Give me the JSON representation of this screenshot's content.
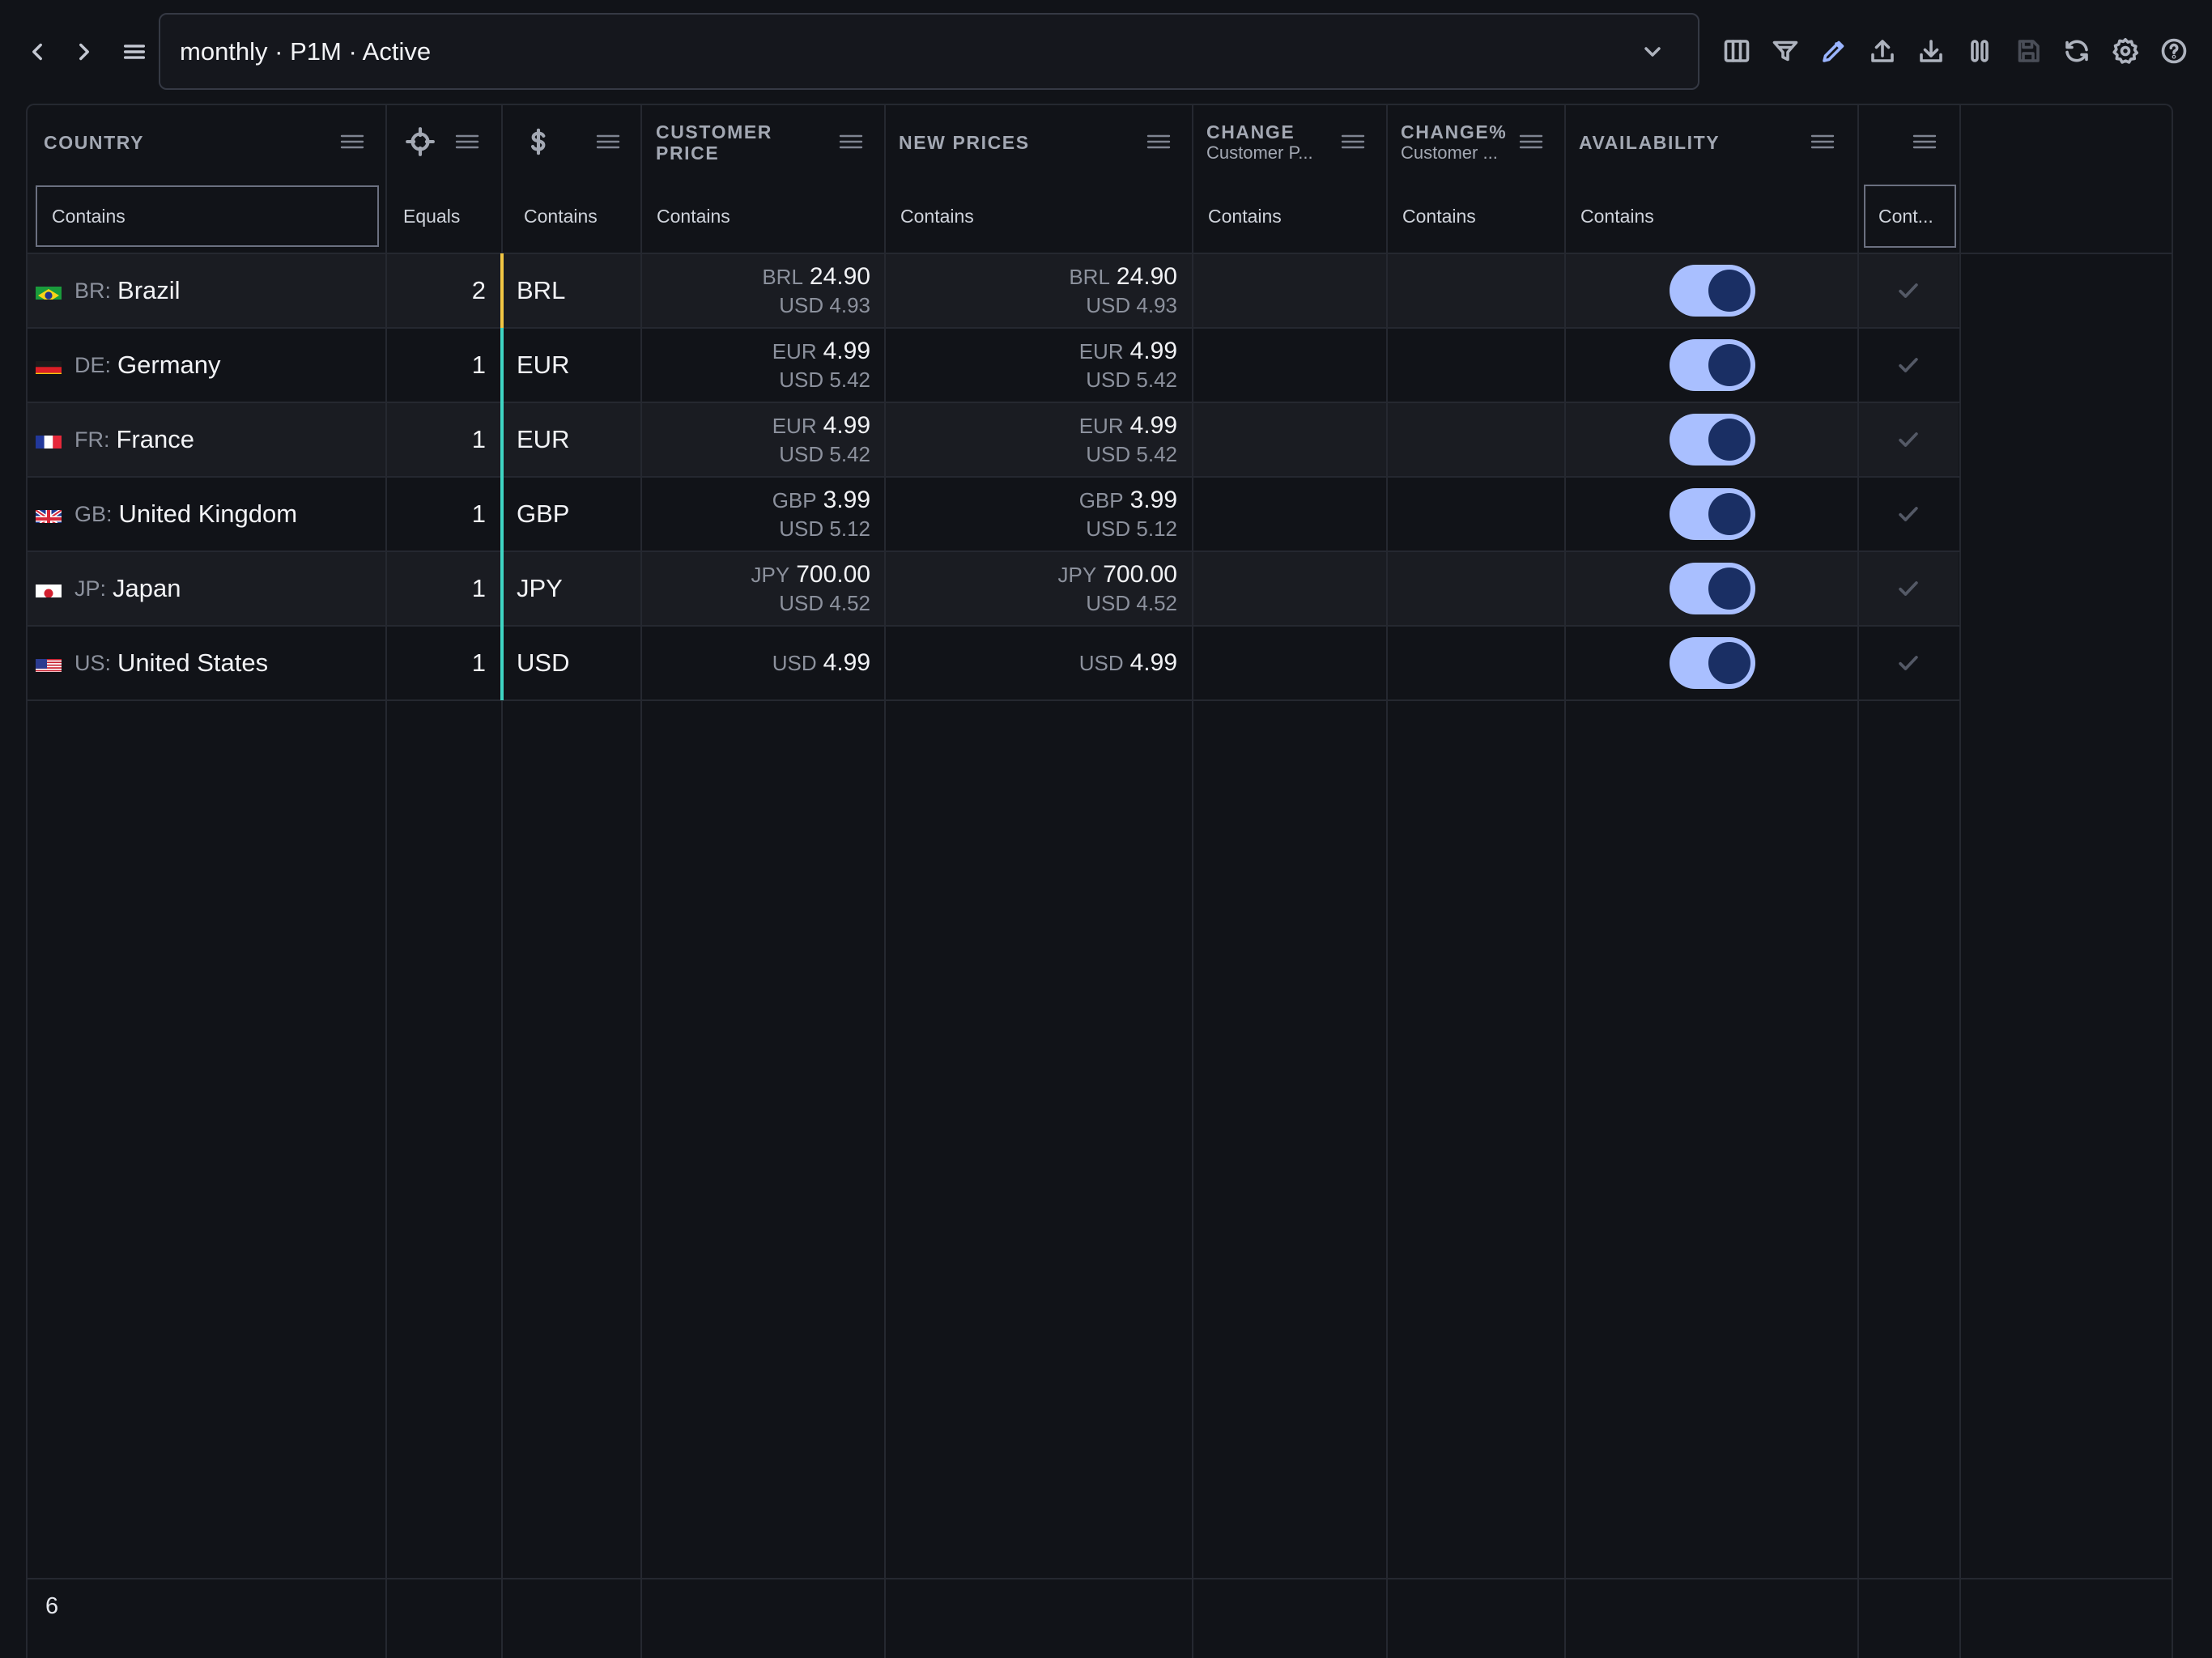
{
  "toolbar": {
    "selector_text": "monthly · P1M · Active",
    "icons": [
      "back-icon",
      "forward-icon",
      "menu-icon",
      "columns-icon",
      "filter-icon",
      "edit-icon",
      "upload-icon",
      "download-icon",
      "pause-icon",
      "save-icon",
      "refresh-icon",
      "settings-icon",
      "help-icon"
    ]
  },
  "columns": {
    "country": "COUNTRY",
    "customer_price_1": "CUSTOMER",
    "customer_price_2": "PRICE",
    "new_prices": "NEW PRICES",
    "change": "CHANGE",
    "change_sub": "Customer P...",
    "change_pct": "CHANGE%",
    "change_pct_sub": "Customer ...",
    "availability": "AVAILABILITY"
  },
  "filters": {
    "country": "Contains",
    "priority": "Equals",
    "currency": "Contains",
    "customer_price": "Contains",
    "new_prices": "Contains",
    "change": "Contains",
    "change_pct": "Contains",
    "availability": "Contains",
    "last": "Cont..."
  },
  "rows": [
    {
      "code": "BR:",
      "name": "Brazil",
      "tier": "2",
      "currency": "BRL",
      "cp_cur": "BRL",
      "cp_val": "24.90",
      "cp_usd": "USD 4.93",
      "np_cur": "BRL",
      "np_val": "24.90",
      "np_usd": "USD 4.93",
      "available": true,
      "accent": "#f2c744"
    },
    {
      "code": "DE:",
      "name": "Germany",
      "tier": "1",
      "currency": "EUR",
      "cp_cur": "EUR",
      "cp_val": "4.99",
      "cp_usd": "USD 5.42",
      "np_cur": "EUR",
      "np_val": "4.99",
      "np_usd": "USD 5.42",
      "available": true,
      "accent": "#3fd6c4"
    },
    {
      "code": "FR:",
      "name": "France",
      "tier": "1",
      "currency": "EUR",
      "cp_cur": "EUR",
      "cp_val": "4.99",
      "cp_usd": "USD 5.42",
      "np_cur": "EUR",
      "np_val": "4.99",
      "np_usd": "USD 5.42",
      "available": true,
      "accent": "#3fd6c4"
    },
    {
      "code": "GB:",
      "name": "United Kingdom",
      "tier": "1",
      "currency": "GBP",
      "cp_cur": "GBP",
      "cp_val": "3.99",
      "cp_usd": "USD 5.12",
      "np_cur": "GBP",
      "np_val": "3.99",
      "np_usd": "USD 5.12",
      "available": true,
      "accent": "#3fd6c4"
    },
    {
      "code": "JP:",
      "name": "Japan",
      "tier": "1",
      "currency": "JPY",
      "cp_cur": "JPY",
      "cp_val": "700.00",
      "cp_usd": "USD 4.52",
      "np_cur": "JPY",
      "np_val": "700.00",
      "np_usd": "USD 4.52",
      "available": true,
      "accent": "#3fd6c4"
    },
    {
      "code": "US:",
      "name": "United States",
      "tier": "1",
      "currency": "USD",
      "cp_cur": "USD",
      "cp_val": "4.99",
      "cp_usd": "",
      "np_cur": "USD",
      "np_val": "4.99",
      "np_usd": "",
      "available": true,
      "accent": "#3fd6c4"
    }
  ],
  "footer": {
    "count": "6"
  },
  "colors": {
    "accent_toggle": "#a9bfff",
    "knob": "#1a2f64",
    "background": "#111318"
  }
}
